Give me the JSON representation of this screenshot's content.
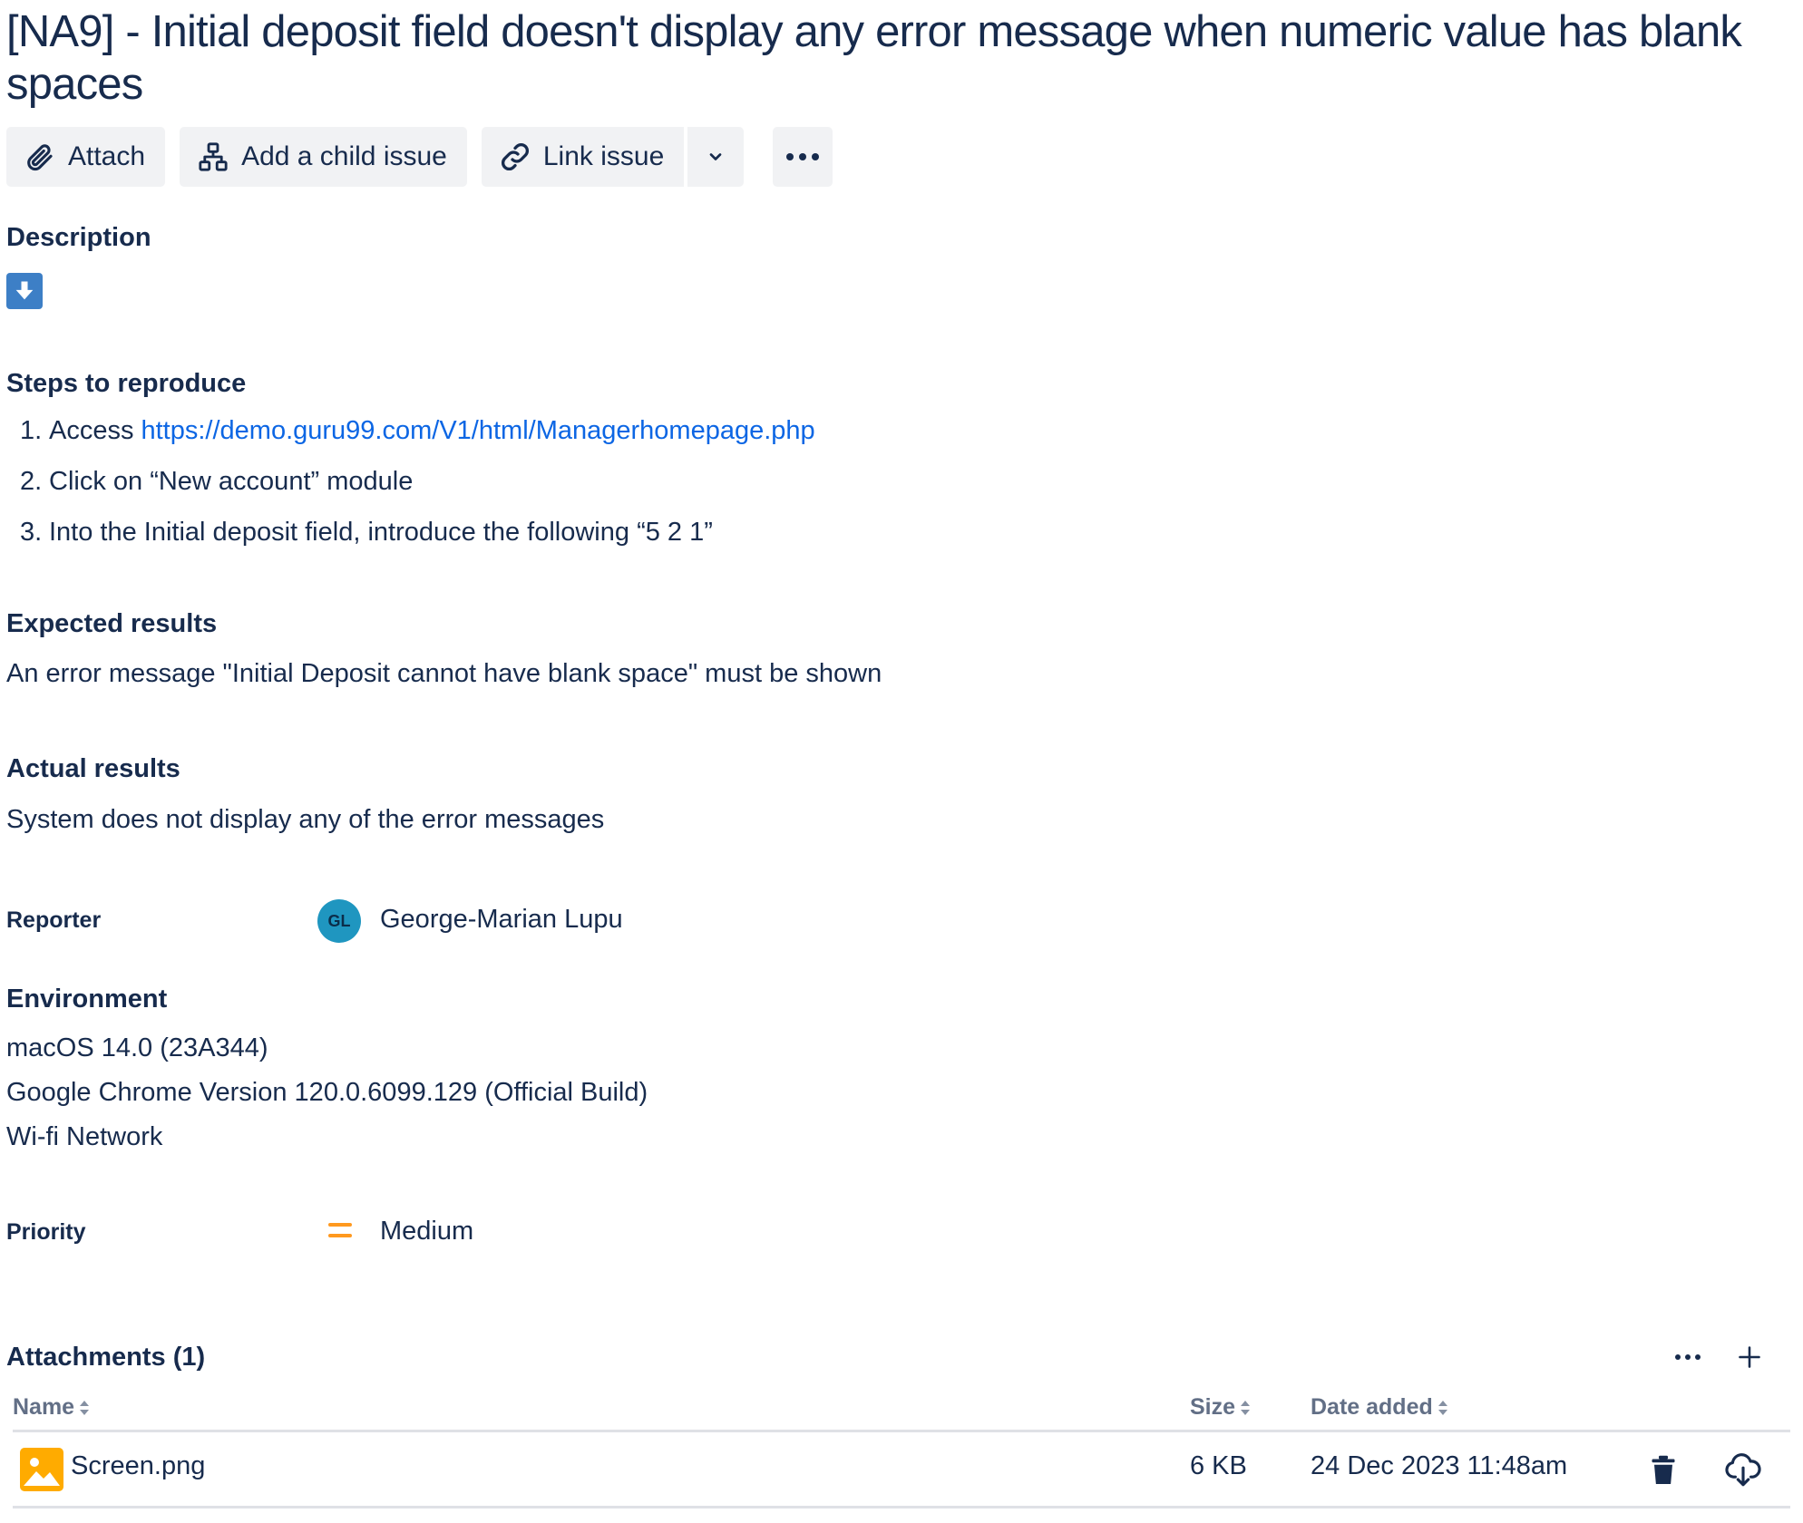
{
  "issue": {
    "title": "[NA9] - Initial deposit field doesn't display any error message when numeric value has blank spaces"
  },
  "toolbar": {
    "attach_label": "Attach",
    "attach_icon": "paperclip-icon",
    "add_child_label": "Add a child issue",
    "add_child_icon": "hierarchy-icon",
    "link_label": "Link issue",
    "link_icon": "link-icon",
    "dropdown_icon": "chevron-down-icon",
    "more_icon": "more-icon"
  },
  "description": {
    "heading": "Description",
    "icon": "arrow-down-icon",
    "icon_color": "#3d7fc6",
    "steps_heading": "Steps to reproduce",
    "steps": [
      {
        "num": "1.",
        "text": "Access",
        "link": "https://demo.guru99.com/V1/html/Managerhomepage.php"
      },
      {
        "num": "2.",
        "text": "Click on “New account” module"
      },
      {
        "num": "3.",
        "text": "Into the Initial deposit field, introduce the following “5 2 1”"
      }
    ],
    "expected_heading": "Expected results",
    "expected_text": "An error message \"Initial Deposit cannot have blank space\" must be shown",
    "actual_heading": "Actual results",
    "actual_text": "System does not display any of the error messages"
  },
  "reporter": {
    "label": "Reporter",
    "initials": "GL",
    "name": "George-Marian Lupu",
    "avatar_color": "#1f96c0"
  },
  "environment": {
    "heading": "Environment",
    "lines": [
      "macOS 14.0 (23A344)",
      "Google Chrome Version 120.0.6099.129 (Official Build)",
      "Wi-fi Network"
    ]
  },
  "priority": {
    "label": "Priority",
    "value": "Medium",
    "icon": "priority-medium-icon",
    "color": "#ff991f"
  },
  "attachments": {
    "heading": "Attachments (1)",
    "columns": {
      "name": "Name",
      "size": "Size",
      "date": "Date added"
    },
    "rows": [
      {
        "icon": "image-file-icon",
        "name": "Screen.png",
        "size": "6 KB",
        "date": "24 Dec 2023 11:48am"
      }
    ],
    "more_icon": "more-icon",
    "add_icon": "plus-icon",
    "delete_icon": "trash-icon",
    "download_icon": "cloud-download-icon"
  },
  "colors": {
    "text": "#172b4d",
    "link": "#0c66e4",
    "button_bg": "#f1f2f4",
    "muted": "#626f86"
  }
}
